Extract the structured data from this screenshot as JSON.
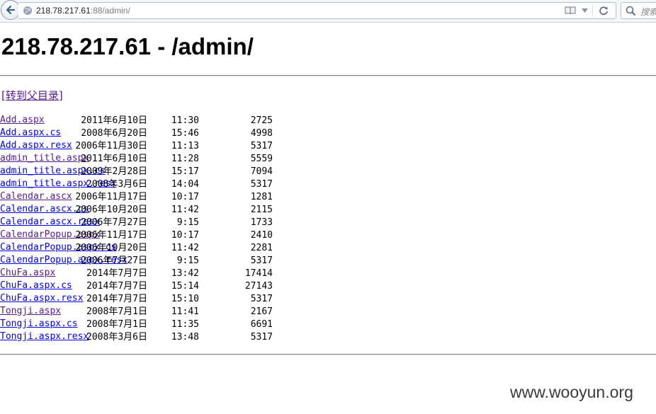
{
  "browser": {
    "url_host": "218.78.217.61",
    "url_rest": ":88/admin/",
    "search_placeholder": "搜索"
  },
  "page": {
    "title": "218.78.217.61 - /admin/",
    "parent_link": "[转到父目录]",
    "listing": [
      {
        "date": "2011年6月10日",
        "time": "11:30",
        "size": "2725",
        "name": "Add.aspx",
        "visited": true
      },
      {
        "date": "2008年6月20日",
        "time": "15:46",
        "size": "4998",
        "name": "Add.aspx.cs",
        "visited": false
      },
      {
        "date": "2006年11月30日",
        "time": "11:13",
        "size": "5317",
        "name": "Add.aspx.resx",
        "visited": false
      },
      {
        "date": "2011年6月10日",
        "time": "11:28",
        "size": "5559",
        "name": "admin_title.aspx",
        "visited": true
      },
      {
        "date": "2009年2月28日",
        "time": "15:17",
        "size": "7094",
        "name": "admin_title.aspx.cs",
        "visited": false
      },
      {
        "date": "2008年3月6日",
        "time": "14:04",
        "size": "5317",
        "name": "admin_title.aspx.resx",
        "visited": false
      },
      {
        "date": "2006年11月17日",
        "time": "10:17",
        "size": "1281",
        "name": "Calendar.ascx",
        "visited": true
      },
      {
        "date": "2006年10月20日",
        "time": "11:42",
        "size": "2115",
        "name": "Calendar.ascx.cs",
        "visited": false
      },
      {
        "date": "2006年7月27日",
        "time": "9:15",
        "size": "1733",
        "name": "Calendar.ascx.resx",
        "visited": false
      },
      {
        "date": "2006年11月17日",
        "time": "10:17",
        "size": "2410",
        "name": "CalendarPopup.aspx",
        "visited": true
      },
      {
        "date": "2006年10月20日",
        "time": "11:42",
        "size": "2281",
        "name": "CalendarPopup.aspx.cs",
        "visited": false
      },
      {
        "date": "2006年7月27日",
        "time": "9:15",
        "size": "5317",
        "name": "CalendarPopup.aspx.resx",
        "visited": false
      },
      {
        "date": "2014年7月7日",
        "time": "13:42",
        "size": "17414",
        "name": "ChuFa.aspx",
        "visited": true
      },
      {
        "date": "2014年7月7日",
        "time": "15:14",
        "size": "27143",
        "name": "ChuFa.aspx.cs",
        "visited": false
      },
      {
        "date": "2014年7月7日",
        "time": "15:10",
        "size": "5317",
        "name": "ChuFa.aspx.resx",
        "visited": false
      },
      {
        "date": "2008年7月1日",
        "time": "11:41",
        "size": "2167",
        "name": "Tongji.aspx",
        "visited": true
      },
      {
        "date": "2008年7月1日",
        "time": "11:35",
        "size": "6691",
        "name": "Tongji.aspx.cs",
        "visited": false
      },
      {
        "date": "2008年3月6日",
        "time": "13:48",
        "size": "5317",
        "name": "Tongji.aspx.resx",
        "visited": false
      }
    ]
  },
  "watermark": "www.wooyun.org",
  "colors": {
    "link_visited": "#551a8b",
    "link_unvisited": "#0000ee"
  }
}
